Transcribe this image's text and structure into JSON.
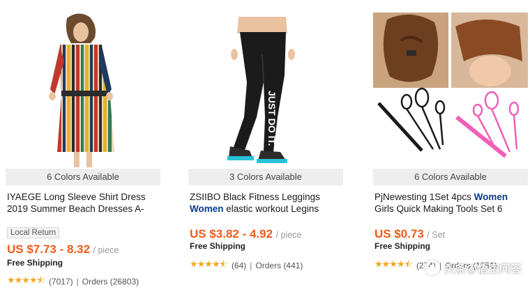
{
  "products": [
    {
      "colors_available": "6 Colors Available",
      "title_line1": "IYAEGE Long Sleeve Shirt Dress",
      "title_line2": "2019 Summer Beach Dresses A-",
      "badge": "Local Return",
      "price": "US $7.73 - 8.32",
      "unit": "/ piece",
      "shipping": "Free Shipping",
      "rating_stars": 4.5,
      "reviews": "(7017)",
      "orders": "Orders (26803)",
      "image": "striped-shirt-dress-photo"
    },
    {
      "colors_available": "3 Colors Available",
      "title_line1": "ZSIIBO Black Fitness Leggings",
      "title_line2_bold": "Women",
      "title_line2_rest": " elastic workout Legins",
      "price": "US $3.82 - 4.92",
      "unit": "/ piece",
      "shipping": "Free Shipping",
      "rating_stars": 4.5,
      "reviews": "(64)",
      "orders": "Orders (441)",
      "legging_text": "JUST DO IT.",
      "image": "black-leggings-photo"
    },
    {
      "colors_available": "6 Colors Available",
      "title_line1_plain": "PjNewesting 1Set 4pcs ",
      "title_line1_bold": "Women",
      "title_line2": "Girls Quick Making Tools Set 6",
      "price": "US $0.73",
      "unit": "/ Set",
      "shipping": "Free Shipping",
      "rating_stars": 4.5,
      "reviews": "(274)",
      "orders": "Orders (1251)",
      "image": "hair-styling-tools-photo"
    }
  ],
  "colors": {
    "price": "#f05a1a",
    "star": "#f5a623",
    "keyword": "#0a3a8a"
  },
  "watermark": {
    "text": "头条@悟空问答"
  }
}
